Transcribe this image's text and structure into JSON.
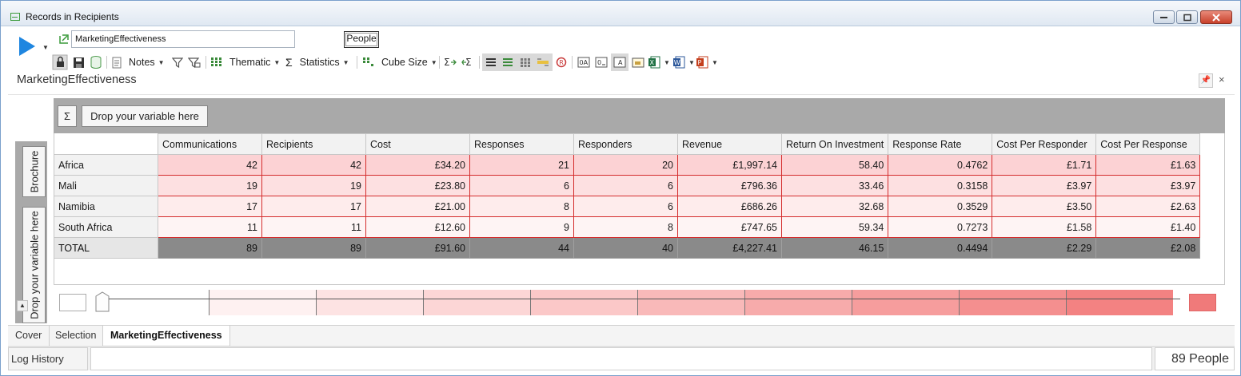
{
  "window": {
    "title": "Records in Recipients"
  },
  "header": {
    "name_value": "MarketingEffectiveness",
    "people_label": "People",
    "heading": "MarketingEffectiveness"
  },
  "toolbar": {
    "notes_label": "Notes",
    "thematic_label": "Thematic",
    "statistics_label": "Statistics",
    "cube_size_label": "Cube Size"
  },
  "drop_zones": {
    "column_drop": "Drop your variable here",
    "sigma": "Σ",
    "row_variable": "Brochure",
    "row_drop": "Drop your variable here"
  },
  "table": {
    "columns": [
      "Communications",
      "Recipients",
      "Cost",
      "Responses",
      "Responders",
      "Revenue",
      "Return On Investment",
      "Response Rate",
      "Cost Per Responder",
      "Cost Per Response"
    ],
    "rows": [
      {
        "label": "Africa",
        "cells": [
          "42",
          "42",
          "£34.20",
          "21",
          "20",
          "£1,997.14",
          "58.40",
          "0.4762",
          "£1.71",
          "£1.63"
        ]
      },
      {
        "label": "Mali",
        "cells": [
          "19",
          "19",
          "£23.80",
          "6",
          "6",
          "£796.36",
          "33.46",
          "0.3158",
          "£3.97",
          "£3.97"
        ]
      },
      {
        "label": "Namibia",
        "cells": [
          "17",
          "17",
          "£21.00",
          "8",
          "6",
          "£686.26",
          "32.68",
          "0.3529",
          "£3.50",
          "£2.63"
        ]
      },
      {
        "label": "South Africa",
        "cells": [
          "11",
          "11",
          "£12.60",
          "9",
          "8",
          "£747.65",
          "59.34",
          "0.7273",
          "£1.58",
          "£1.40"
        ]
      }
    ],
    "total": {
      "label": "TOTAL",
      "cells": [
        "89",
        "89",
        "£91.60",
        "44",
        "40",
        "£4,227.41",
        "46.15",
        "0.4494",
        "£2.29",
        "£2.08"
      ]
    },
    "row_shades": [
      "#fcd2d4",
      "#fde0e1",
      "#feecec",
      "#fef4f4"
    ]
  },
  "legend": {
    "start_color": "#ffffff",
    "end_color": "#f07a7a",
    "bands": [
      "#fef1f1",
      "#fde3e3",
      "#fcd6d6",
      "#fbc8c8",
      "#f9b9b9",
      "#f7abab",
      "#f69d9d",
      "#f48f8f",
      "#f38282"
    ]
  },
  "tabs": [
    {
      "label": "Cover",
      "active": false
    },
    {
      "label": "Selection",
      "active": false
    },
    {
      "label": "MarketingEffectiveness",
      "active": true
    }
  ],
  "status": {
    "log_history": "Log History",
    "people_count": "89 People"
  }
}
